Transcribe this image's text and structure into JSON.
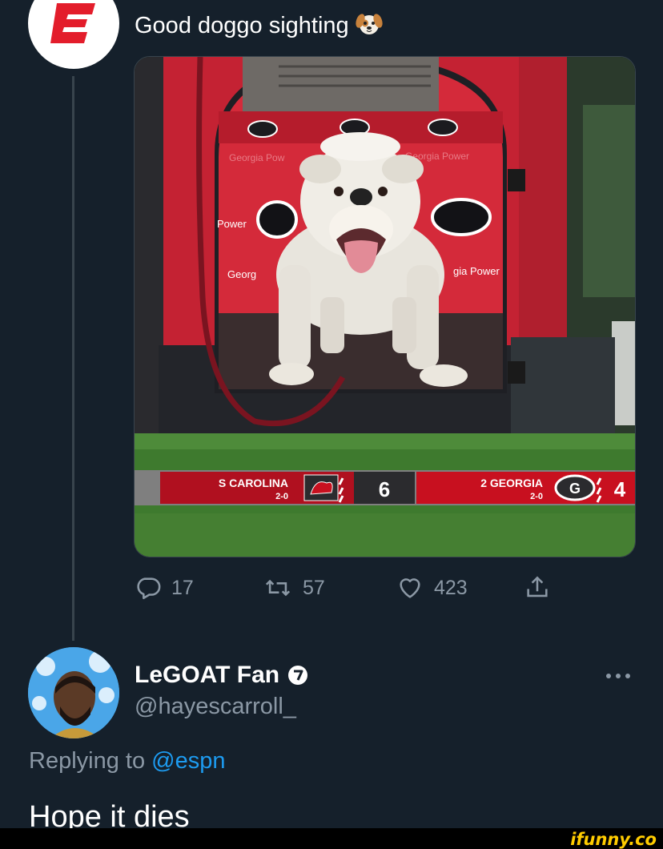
{
  "tweet": {
    "text": "Good doggo sighting",
    "emoji": "dog-face-emoji",
    "media": {
      "scoreboard": {
        "away_team": "S CAROLINA",
        "away_record": "2-0",
        "away_score": "6",
        "home_team": "2 GEORGIA",
        "home_record": "2-0",
        "home_score": "4"
      },
      "banner_text": {
        "power_left": "Power",
        "georgia_left": "Georg",
        "power_right": "gia Power",
        "georgia_power_top": "Georgia Pow",
        "georgia_power_top_right": "Georgia Power"
      }
    },
    "actions": {
      "replies": "17",
      "retweets": "57",
      "likes": "423"
    }
  },
  "reply": {
    "name": "LeGOAT Fan",
    "handle": "@hayescarroll_",
    "replying_prefix": "Replying to",
    "replying_to": "@espn",
    "text": "Hope it dies"
  },
  "footer": {
    "watermark": "ifunny.co"
  },
  "colors": {
    "background": "#15202b",
    "secondary_text": "#8b98a5",
    "link": "#1d9bf0",
    "espn_red": "#e31d2b",
    "georgia_red": "#cc1f2e"
  }
}
